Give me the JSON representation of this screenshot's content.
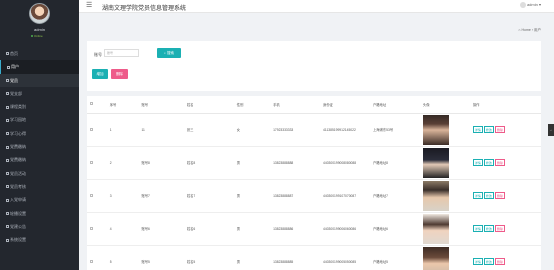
{
  "app": {
    "title": "湖南文理学院党员信息管理系统"
  },
  "sidebar": {
    "user_name": "admin",
    "status": "Online",
    "items": [
      {
        "label": "首页",
        "state": "normal"
      },
      {
        "label": "用户",
        "state": "active"
      },
      {
        "label": "党员",
        "state": "hover"
      },
      {
        "label": "党支部",
        "state": "normal"
      },
      {
        "label": "课程类别",
        "state": "normal"
      },
      {
        "label": "学习园地",
        "state": "normal"
      },
      {
        "label": "学习心得",
        "state": "normal"
      },
      {
        "label": "党费缴纳",
        "state": "normal"
      },
      {
        "label": "党费缴纳",
        "state": "normal"
      },
      {
        "label": "党员活动",
        "state": "normal"
      },
      {
        "label": "党员考核",
        "state": "normal"
      },
      {
        "label": "入党申请",
        "state": "normal"
      },
      {
        "label": "轮播设置",
        "state": "normal"
      },
      {
        "label": "党建公告",
        "state": "normal"
      },
      {
        "label": "系统设置",
        "state": "normal"
      }
    ]
  },
  "topbar": {
    "user": "admin"
  },
  "breadcrumb": {
    "home": "Home",
    "current": "用户"
  },
  "search": {
    "label": "账号",
    "placeholder": "账号",
    "button": "搜索"
  },
  "actions": {
    "add": "增加",
    "delete": "删除"
  },
  "table": {
    "columns": [
      "",
      "序号",
      "账号",
      "姓名",
      "性别",
      "手机",
      "身份证",
      "户籍地址",
      "头像",
      "操作"
    ],
    "rows": [
      {
        "index": "1",
        "account": "11",
        "name": "张三",
        "gender": "女",
        "phone": "17923333333",
        "id_card": "411385199912145022",
        "address": "上海浦东53号",
        "photo": "ph1"
      },
      {
        "index": "2",
        "account": "账号8",
        "name": "姓名8",
        "gender": "男",
        "phone": "13823888888",
        "id_card": "440300199008080088",
        "address": "户籍地址8",
        "photo": "ph2"
      },
      {
        "index": "3",
        "account": "账号7",
        "name": "姓名7",
        "gender": "男",
        "phone": "13823888887",
        "id_card": "440300199107070087",
        "address": "户籍地址7",
        "photo": "ph3"
      },
      {
        "index": "4",
        "account": "账号6",
        "name": "姓名6",
        "gender": "男",
        "phone": "13823888886",
        "id_card": "440300199006060086",
        "address": "户籍地址6",
        "photo": "ph4"
      },
      {
        "index": "5",
        "account": "账号5",
        "name": "姓名5",
        "gender": "男",
        "phone": "13823888885",
        "id_card": "440300199005050085",
        "address": "户籍地址5",
        "photo": "ph5"
      }
    ],
    "op_labels": {
      "detail": "详情",
      "edit": "修改",
      "delete": "删除"
    }
  },
  "colors": {
    "accent": "#1bb0b3",
    "danger": "#ee5b8a",
    "sidebar": "#23272e"
  }
}
